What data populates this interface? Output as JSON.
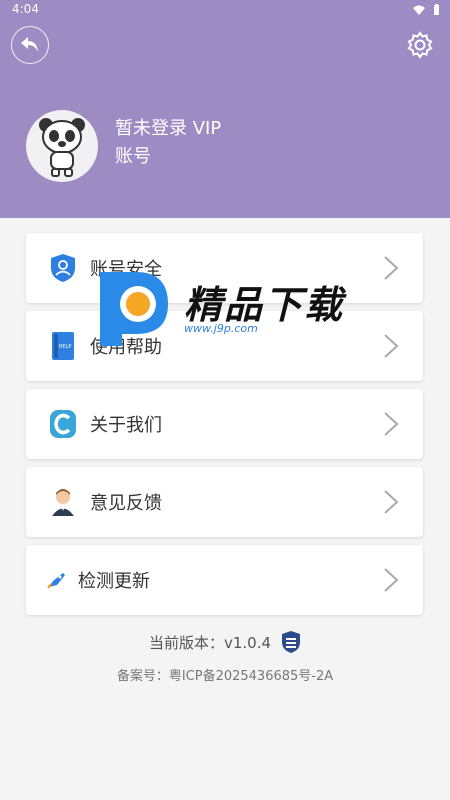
{
  "status_bar": {
    "time": "4:04",
    "icons": [
      "wifi-icon",
      "battery-icon"
    ]
  },
  "header": {
    "bg_color": "#9d8bc4",
    "back_icon": "back-arrow-icon",
    "settings_icon": "gear-icon"
  },
  "user": {
    "name": "暂未登录  VIP",
    "subtitle": "账号",
    "avatar_icon": "panda-avatar"
  },
  "menu": [
    {
      "label": "账号安全",
      "icon": "shield-user-icon"
    },
    {
      "label": "使用帮助",
      "icon": "help-book-icon"
    },
    {
      "label": "关于我们",
      "icon": "about-logo-icon"
    },
    {
      "label": "意见反馈",
      "icon": "feedback-person-icon"
    },
    {
      "label": "检测更新",
      "icon": "rocket-update-icon"
    }
  ],
  "footer": {
    "version_label": "当前版本：v1.0.4",
    "record_label": "备案号：粤ICP备2025436685号-2A",
    "badge_icon": "version-badge-icon"
  },
  "watermark": {
    "title": "精品下载",
    "url": "www.j9p.com",
    "logo": "p-logo"
  }
}
